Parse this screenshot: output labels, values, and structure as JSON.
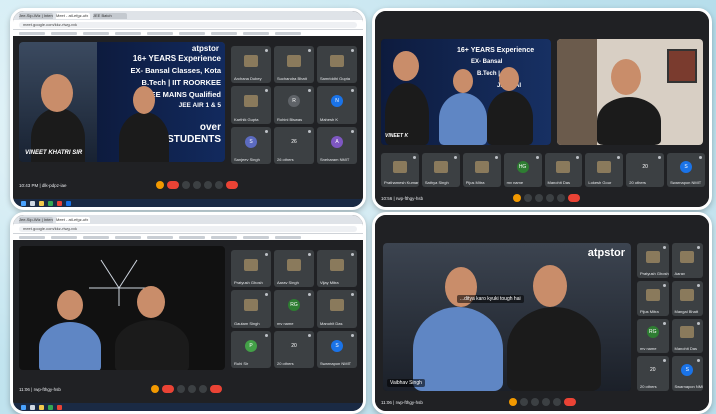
{
  "shots": [
    {
      "browser": {
        "tabs": [
          "Jee-Sip-Wiz | Intensive",
          "Meet - atl-efgz-ufx",
          "JEE Batch"
        ],
        "url": "meet.google.com/kkz-rtwg-vxk",
        "bookmarks": 11
      },
      "stage": {
        "brand": "atpstor",
        "lines": [
          "16+ YEARS Experience",
          "EX- Bansal Classes, Kota",
          "B.Tech | IIT ROORKEE",
          "JEE MAINS Qualified",
          "JEE AIR 1 & 5",
          "over",
          "STUDENTS"
        ],
        "caption": "VINEET KHATRI SIR"
      },
      "tiles": [
        {
          "name": "Archana Dubey",
          "type": "photo"
        },
        {
          "name": "Suchandra Bhatt",
          "type": "photo"
        },
        {
          "name": "Samriddhi Gupta",
          "type": "photo"
        },
        {
          "name": "Karthik Gupta",
          "type": "photo"
        },
        {
          "name": "Rohini Biswas",
          "type": "avatar",
          "initial": "R",
          "color": "#5f6368"
        },
        {
          "name": "Mahesh K",
          "type": "avatar",
          "initial": "N",
          "color": "#1a73e8"
        },
        {
          "name": "Sanjeev Singh",
          "type": "avatar",
          "initial": "S",
          "color": "#5c6bc0"
        },
        {
          "name": "26 others",
          "type": "avatar",
          "initial": "26",
          "color": "#3c4043"
        },
        {
          "name": "Sneharam NMIT",
          "type": "avatar",
          "initial": "A",
          "color": "#7e57c2"
        }
      ],
      "meeting_time": "10:43 PM | dlk-pdpz-iae"
    },
    {
      "stage": {
        "lines": [
          "16+ YEARS Experience",
          "EX- Bansal",
          "B.Tech | IIT",
          "JEE MAI",
          "VINEET K"
        ]
      },
      "tiles": [
        {
          "name": "Prathamesh Kumar",
          "type": "photo"
        },
        {
          "name": "Sathya Singh",
          "type": "photo"
        },
        {
          "name": "Pijus Mitra",
          "type": "photo"
        },
        {
          "name": "mv name",
          "type": "avatar",
          "initial": "HG",
          "color": "#2e7d32"
        },
        {
          "name": "Manohit Das",
          "type": "photo"
        },
        {
          "name": "Lokesh Gour",
          "type": "photo"
        },
        {
          "name": "20 others",
          "type": "avatar",
          "initial": "20",
          "color": "#3c4043"
        },
        {
          "name": "Swarnapon NMIT",
          "type": "avatar",
          "initial": "S",
          "color": "#1a73e8"
        }
      ],
      "meeting_time": "10:56 | rwp-fthgy-hsb"
    },
    {
      "browser": {
        "tabs": [
          "Jee-Sip-Wiz | Intensive",
          "Meet - atl-efgz-ufx"
        ],
        "url": "meet.google.com/kkz-rtwg-vxk",
        "bookmarks": 11
      },
      "tiles": [
        {
          "name": "Pratyush Ghosh",
          "type": "photo"
        },
        {
          "name": "Aarav Singh",
          "type": "photo"
        },
        {
          "name": "Vijay Mitra",
          "type": "photo"
        },
        {
          "name": "Gautam Singh",
          "type": "photo"
        },
        {
          "name": "mv name",
          "type": "avatar",
          "initial": "RG",
          "color": "#2e7d32"
        },
        {
          "name": "Manohit Das",
          "type": "photo"
        },
        {
          "name": "Ruhi Sir",
          "type": "avatar",
          "initial": "P",
          "color": "#43a047"
        },
        {
          "name": "20 others",
          "type": "avatar",
          "initial": "20",
          "color": "#3c4043"
        },
        {
          "name": "Swarnapon NMIT",
          "type": "avatar",
          "initial": "S",
          "color": "#1a73e8"
        }
      ],
      "meeting_time": "11:06 | rwp-fthgy-hsb"
    },
    {
      "stage": {
        "brand": "atpstor",
        "caption": "Vaibhav Singh",
        "subtitle": "...ditya karo kyuki tough hai"
      },
      "tiles": [
        {
          "name": "Pratyush Ghosh",
          "type": "photo"
        },
        {
          "name": "Aarav",
          "type": "photo"
        },
        {
          "name": "Pijus Mitra",
          "type": "photo"
        },
        {
          "name": "Mangal Bhatt",
          "type": "photo"
        },
        {
          "name": "mv name",
          "type": "avatar",
          "initial": "RG",
          "color": "#2e7d32"
        },
        {
          "name": "Manohit Das",
          "type": "photo"
        },
        {
          "name": "20 others",
          "type": "avatar",
          "initial": "20",
          "color": "#3c4043"
        },
        {
          "name": "Swarnapon NMIT",
          "type": "avatar",
          "initial": "S",
          "color": "#1a73e8"
        }
      ],
      "meeting_time": "11:06 | rwp-fthgy-hsb"
    }
  ]
}
